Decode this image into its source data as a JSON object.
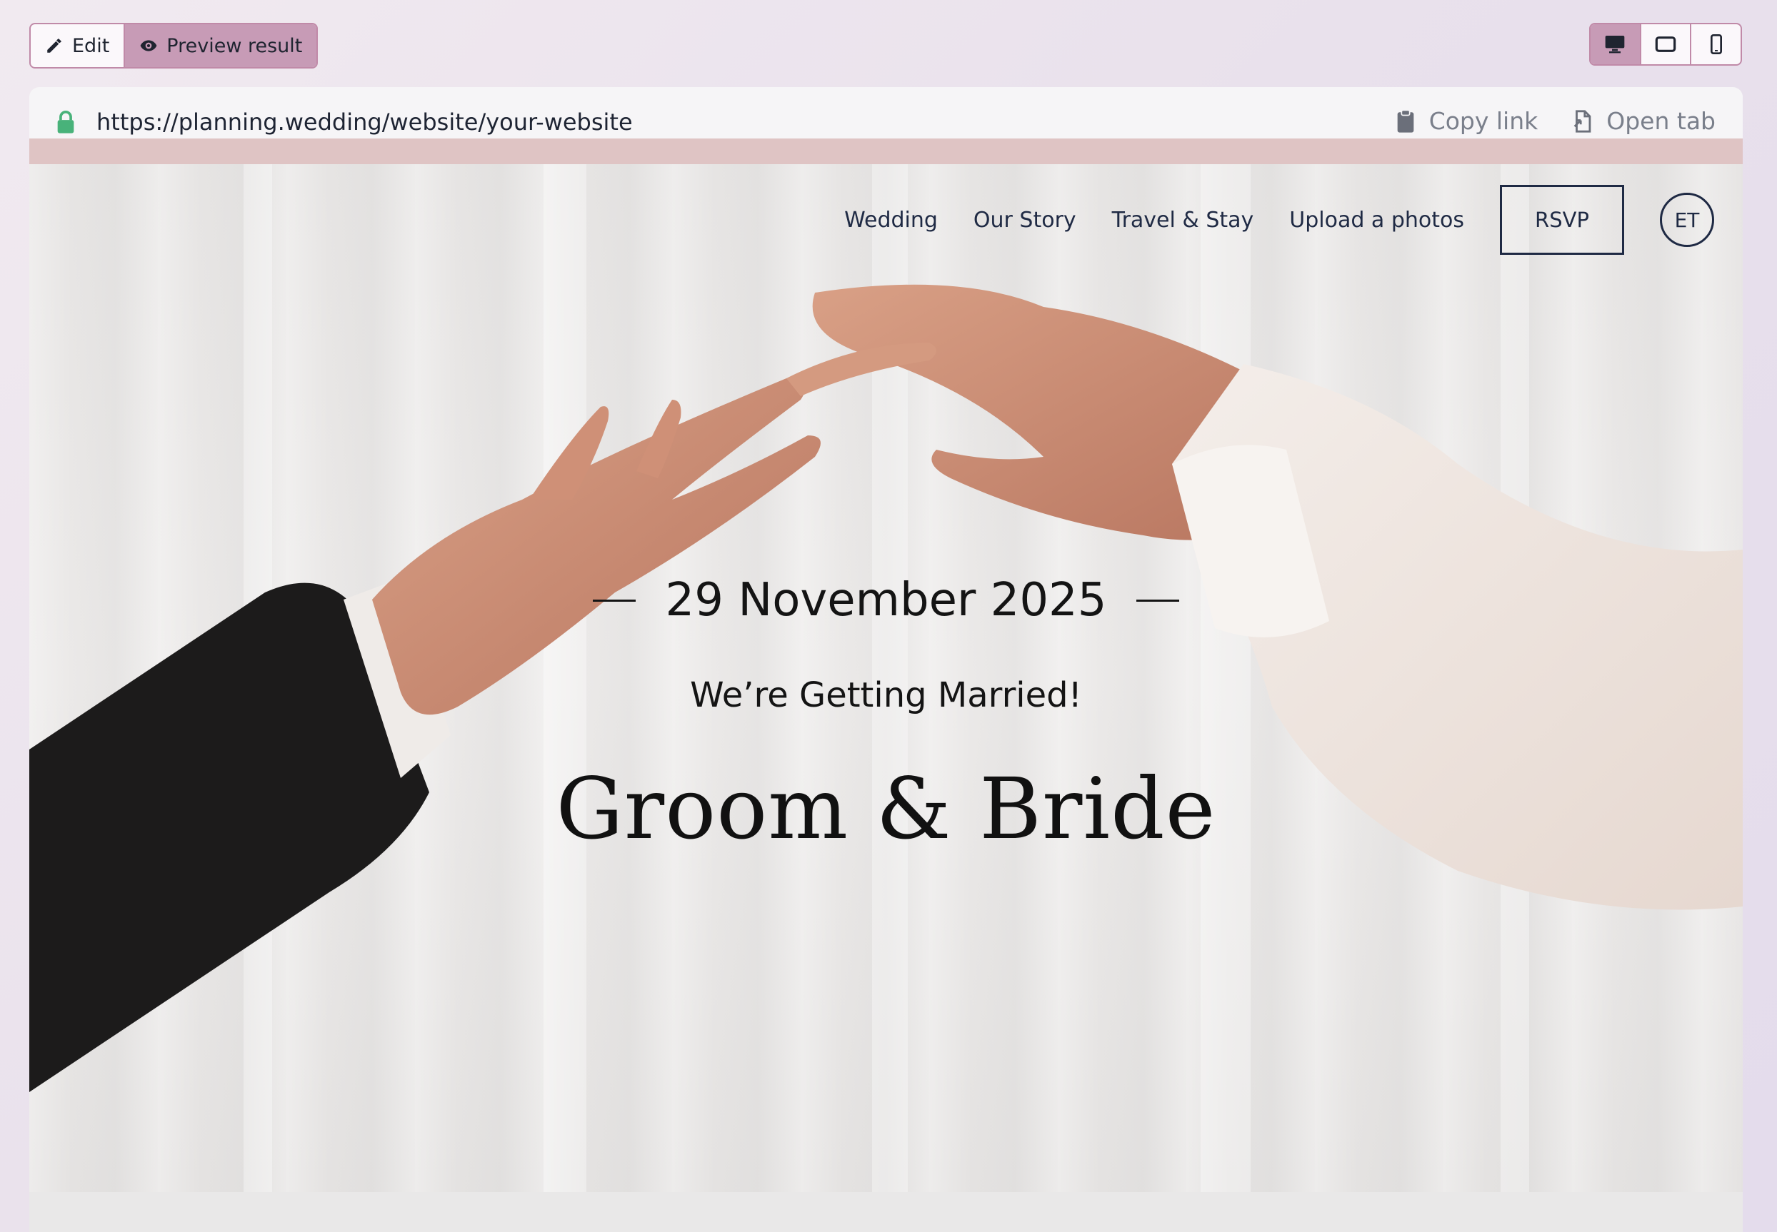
{
  "toolbar": {
    "edit_label": "Edit",
    "preview_label": "Preview result",
    "active_mode": "preview",
    "devices": [
      "desktop",
      "tablet",
      "mobile"
    ],
    "active_device": "desktop",
    "accent_color": "#c79bb6"
  },
  "browser": {
    "url": "https://planning.wedding/website/your-website",
    "copy_link_label": "Copy link",
    "open_tab_label": "Open tab"
  },
  "site": {
    "nav": {
      "items": [
        "Wedding",
        "Our Story",
        "Travel & Stay",
        "Upload a photos"
      ],
      "rsvp_label": "RSVP",
      "language_label": "ET"
    },
    "hero": {
      "date": "29 November 2025",
      "subtitle": "We’re Getting Married!",
      "names": "Groom & Bride"
    }
  },
  "icons": {
    "edit": "pencil-icon",
    "preview": "eye-icon",
    "lock": "lock-icon",
    "copy": "clipboard-icon",
    "open": "open-tab-icon",
    "desktop": "desktop-icon",
    "tablet": "tablet-icon",
    "mobile": "mobile-icon"
  }
}
